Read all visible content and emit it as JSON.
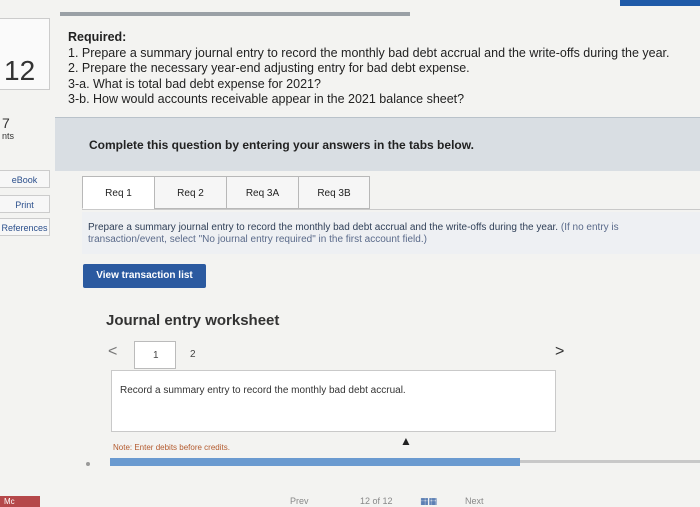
{
  "question": {
    "number": "12",
    "points_value": "7",
    "points_label": "nts"
  },
  "sidebar": {
    "ebook": "eBook",
    "print": "Print",
    "references": "References",
    "mc": "Mc"
  },
  "required": {
    "title": "Required:",
    "lines": [
      "1. Prepare a summary journal entry to record the monthly bad debt accrual and the write-offs during the year.",
      "2. Prepare the necessary year-end adjusting entry for bad debt expense.",
      "3-a. What is total bad debt expense for 2021?",
      "3-b. How would accounts receivable appear in the 2021 balance sheet?"
    ]
  },
  "banner": {
    "text": "Complete this question by entering your answers in the tabs below."
  },
  "tabs": [
    {
      "label": "Req 1",
      "active": true
    },
    {
      "label": "Req 2",
      "active": false
    },
    {
      "label": "Req 3A",
      "active": false
    },
    {
      "label": "Req 3B",
      "active": false
    }
  ],
  "instruction": {
    "main": "Prepare a summary journal entry to record the monthly bad debt accrual and the write-offs during the year.",
    "note": "(If no entry is transaction/event, select \"No journal entry required\" in the first account field.)"
  },
  "buttons": {
    "view_transactions": "View transaction list"
  },
  "worksheet": {
    "title": "Journal entry worksheet",
    "prev": "<",
    "next": ">",
    "page_current": "1",
    "page_next": "2",
    "record_text": "Record a summary entry to record the monthly bad debt accrual.",
    "note": "Note: Enter debits before credits."
  },
  "footer": {
    "prev": "Prev",
    "page_count": "12 of 12",
    "grid_icon": "grid-icon",
    "next": "Next"
  },
  "colors": {
    "accent": "#2b5aa0",
    "banner_bg": "#d9dee3",
    "progress": "#6a9ad0",
    "mc_badge": "#b5484a"
  }
}
